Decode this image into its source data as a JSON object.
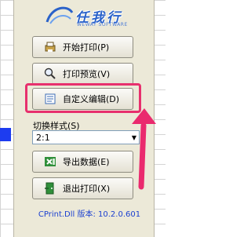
{
  "panel": {
    "logo_text": "任我行",
    "logo_sub": "WEWAY SOFTWARE",
    "buttons": {
      "start_print": "开始打印(P)",
      "preview": "打印预览(V)",
      "custom_edit": "自定义编辑(D)",
      "export": "导出数据(E)",
      "exit": "退出打印(X)"
    },
    "switch_label": "切换样式(S)",
    "select_value": "2:1",
    "version": "CPrint.Dll 版本: 10.2.0.601"
  },
  "colors": {
    "highlight": "#e7306d",
    "version_text": "#1a3fd0"
  }
}
